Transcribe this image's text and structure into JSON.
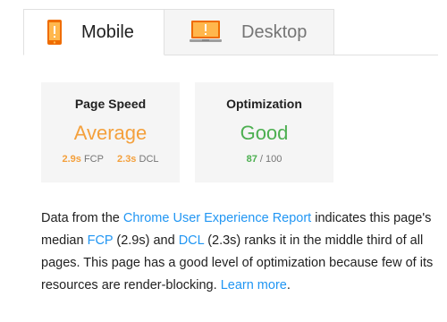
{
  "tabs": [
    {
      "label": "Mobile",
      "active": true,
      "icon": "mobile-phone-icon"
    },
    {
      "label": "Desktop",
      "active": false,
      "icon": "desktop-monitor-icon"
    }
  ],
  "colors": {
    "average": "#f4a03c",
    "good": "#4caf50",
    "link": "#2196f3",
    "card_bg": "#f5f5f5"
  },
  "cards": {
    "page_speed": {
      "title": "Page Speed",
      "value": "Average",
      "fcp_value": "2.9s",
      "fcp_label": "FCP",
      "dcl_value": "2.3s",
      "dcl_label": "DCL"
    },
    "optimization": {
      "title": "Optimization",
      "value": "Good",
      "score": "87",
      "score_max": "/ 100"
    }
  },
  "description": {
    "t1": "Data from the ",
    "link_report": "Chrome User Experience Report",
    "t2": " indicates this page's median ",
    "link_fcp": "FCP",
    "t3": " (2.9s) and ",
    "link_dcl": "DCL",
    "t4": " (2.3s) ranks it in the middle third of all pages. This page has a good level of optimization because few of its resources are render-blocking. ",
    "link_learn": "Learn more",
    "t5": "."
  }
}
